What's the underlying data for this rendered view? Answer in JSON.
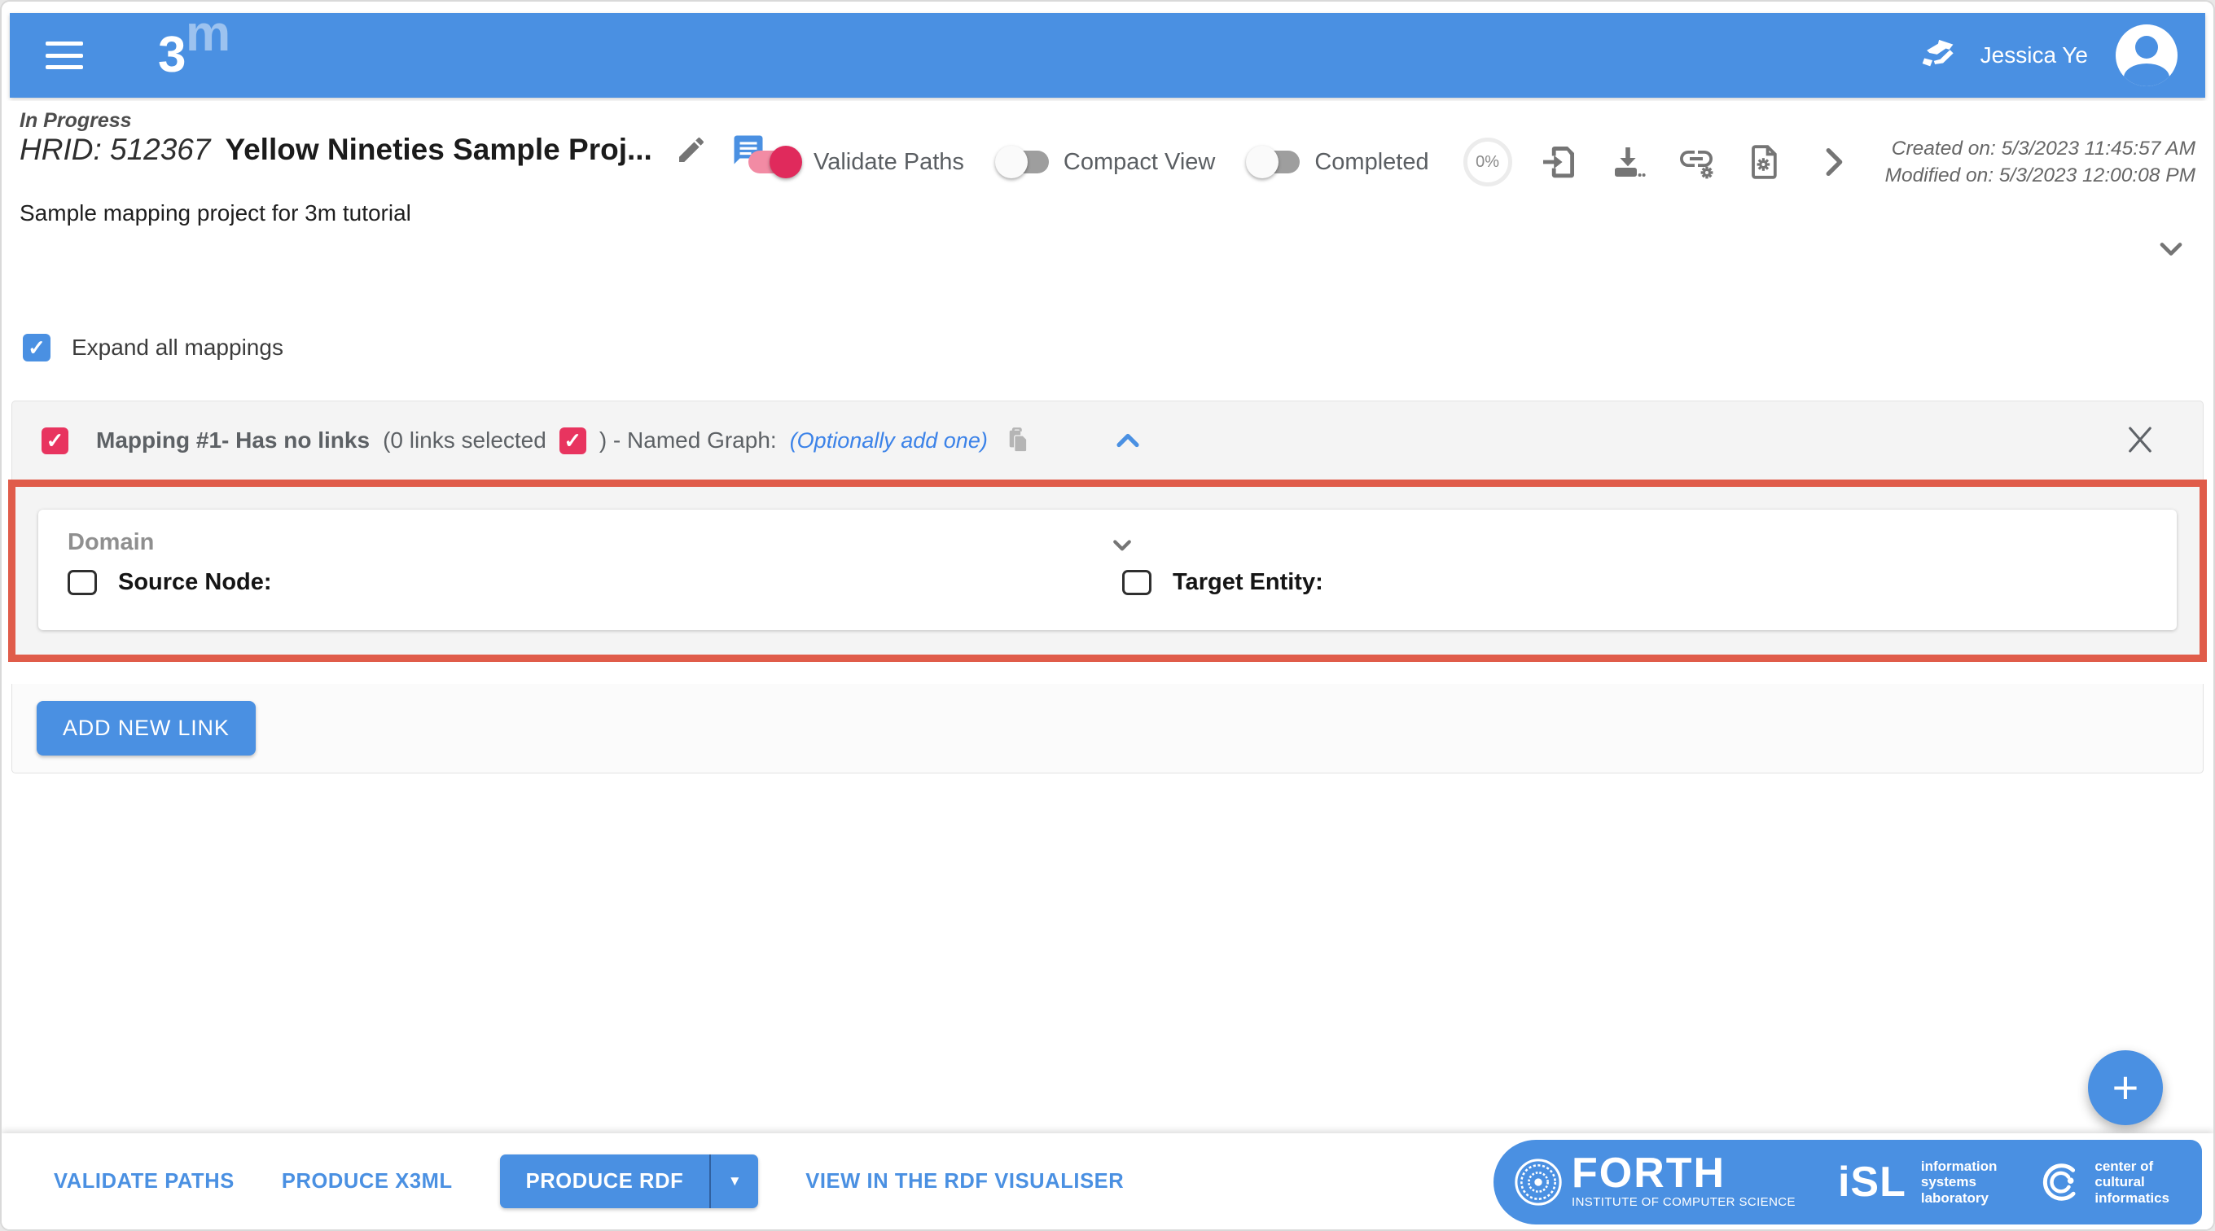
{
  "colors": {
    "primary_blue": "#4a90e2",
    "toggle_pink": "#e02a5c",
    "checkbox_pink": "#e8345f",
    "highlight_red": "#e05c4a"
  },
  "icons": {
    "plus": "+",
    "dropdown_arrow": "▼",
    "check": "✓"
  },
  "header": {
    "logo": "3",
    "user_name": "Jessica Ye"
  },
  "project": {
    "status": "In Progress",
    "hrid": "HRID: 512367",
    "title": "Yellow Nineties Sample Proj...",
    "description": "Sample mapping project for 3m tutorial",
    "progress": "0%",
    "created": "Created on: 5/3/2023 11:45:57 AM",
    "modified": "Modified on: 5/3/2023 12:00:08 PM",
    "toggles": [
      {
        "label": "Validate Paths",
        "on": true
      },
      {
        "label": "Compact View",
        "on": false
      },
      {
        "label": "Completed",
        "on": false
      }
    ]
  },
  "mappings": {
    "expand_all_label": "Expand all mappings",
    "expand_all_checked": true
  },
  "mapping": {
    "checked": true,
    "links_checkbox_checked": true,
    "title": "Mapping #1- Has no links",
    "links_text": "(0 links selected",
    "named_graph_text": ") - Named Graph:",
    "named_graph_link": "(Optionally add one)",
    "domain": {
      "heading": "Domain",
      "source_node_label": "Source Node:",
      "target_entity_label": "Target Entity:"
    },
    "add_link_label": "ADD NEW LINK"
  },
  "footer": {
    "validate_paths": "VALIDATE PATHS",
    "produce_x3ml": "PRODUCE X3ML",
    "produce_rdf": "PRODUCE RDF",
    "view_rdf": "VIEW IN THE RDF VISUALISER",
    "forth": {
      "name": "FORTH",
      "subtitle": "INSTITUTE OF COMPUTER SCIENCE"
    },
    "isl": {
      "logo": "iSL",
      "line1": "information",
      "line2": "systems",
      "line3": "laboratory"
    },
    "cci": {
      "line1": "center of",
      "line2": "cultural",
      "line3": "informatics"
    }
  }
}
